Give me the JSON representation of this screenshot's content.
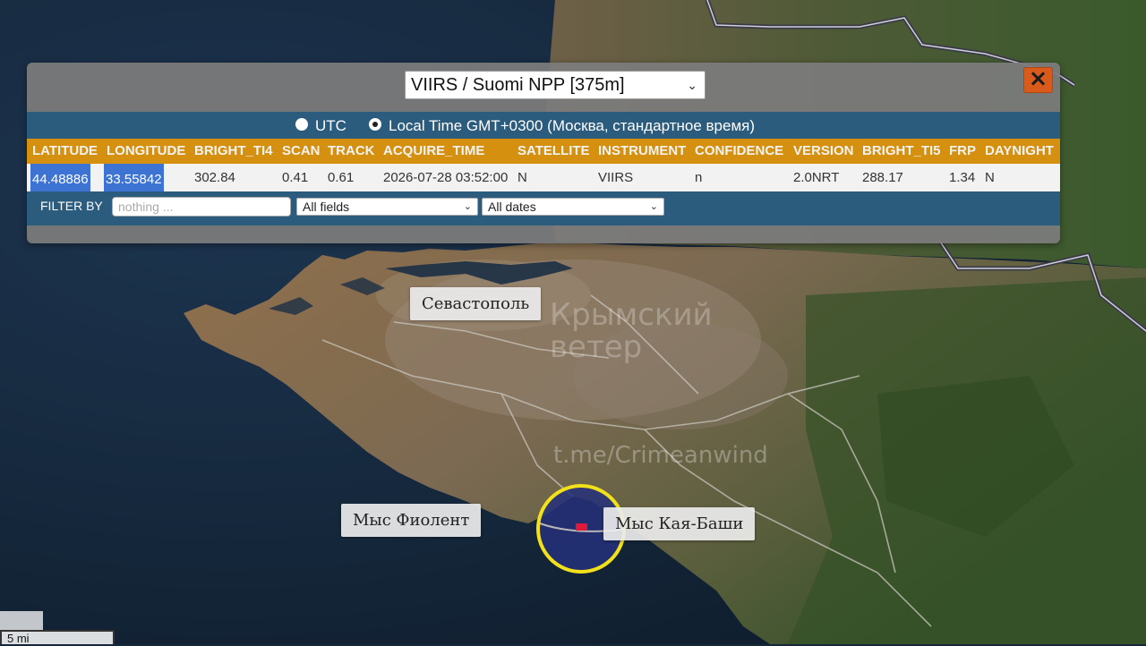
{
  "map": {
    "places": [
      {
        "id": "sevastopol",
        "label": "Севастополь"
      },
      {
        "id": "fiolent",
        "label": "Мыс Фиолент"
      },
      {
        "id": "kaya_bashi",
        "label": "Мыс Кая-Баши"
      }
    ],
    "watermarks": [
      "Крымский",
      "ветер",
      "t.me/Crimeanwind"
    ],
    "scale_label": "5 mi",
    "colors": {
      "sea": "#16273a",
      "land": "#7d6a4d",
      "forest": "#3e5a2b",
      "highlight_ring": "#f2e11a",
      "fire_pixel": "#e0193a"
    }
  },
  "panel": {
    "sensor": "VIIRS / Suomi NPP [375m]",
    "close_icon": "×",
    "timezone": {
      "utc_label": "UTC",
      "local_label": "Local Time GMT+0300 (Москва, стандартное время)",
      "selected": "local"
    },
    "columns": [
      "LATITUDE",
      "LONGITUDE",
      "BRIGHT_TI4",
      "SCAN",
      "TRACK",
      "ACQUIRE_TIME",
      "SATELLITE",
      "INSTRUMENT",
      "CONFIDENCE",
      "VERSION",
      "BRIGHT_TI5",
      "FRP",
      "DAYNIGHT"
    ],
    "row": [
      "44.48886",
      "33.55842",
      "302.84",
      "0.41",
      "0.61",
      "2026-07-28 03:52:00",
      "N",
      "VIIRS",
      "n",
      "2.0NRT",
      "288.17",
      "1.34",
      "N"
    ],
    "filter": {
      "label": "FILTER BY",
      "placeholder": "nothing ...",
      "fields_value": "All fields",
      "dates_value": "All dates"
    },
    "colors": {
      "header": "#d4900e",
      "bar": "#2b5b7d",
      "close": "#d85b1c"
    }
  }
}
